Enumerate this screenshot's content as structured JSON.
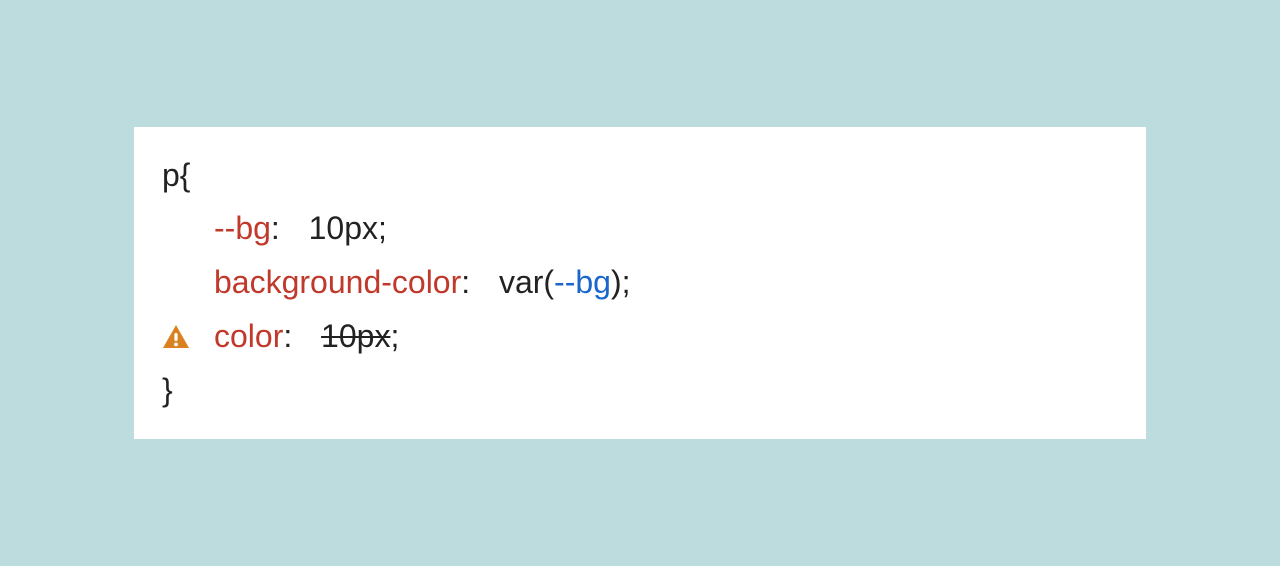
{
  "css_rule": {
    "selector": "p",
    "open_brace": " {",
    "close_brace": "}",
    "lines": {
      "0": {
        "property": "--bg",
        "colon": ": ",
        "value": "10px",
        "semicolon": ";"
      },
      "1": {
        "property": "background-color",
        "colon": ": ",
        "value_prefix": "var(",
        "var_name": "--bg",
        "value_suffix": ")",
        "semicolon": ";"
      },
      "2": {
        "property": "color",
        "colon": ": ",
        "value": "10px",
        "semicolon": ";",
        "warning": true
      }
    }
  },
  "colors": {
    "background": "#bddcdd",
    "panel": "#ffffff",
    "text": "#222222",
    "property": "#c0392b",
    "variable": "#1a66cc",
    "warning": "#d9821f"
  }
}
